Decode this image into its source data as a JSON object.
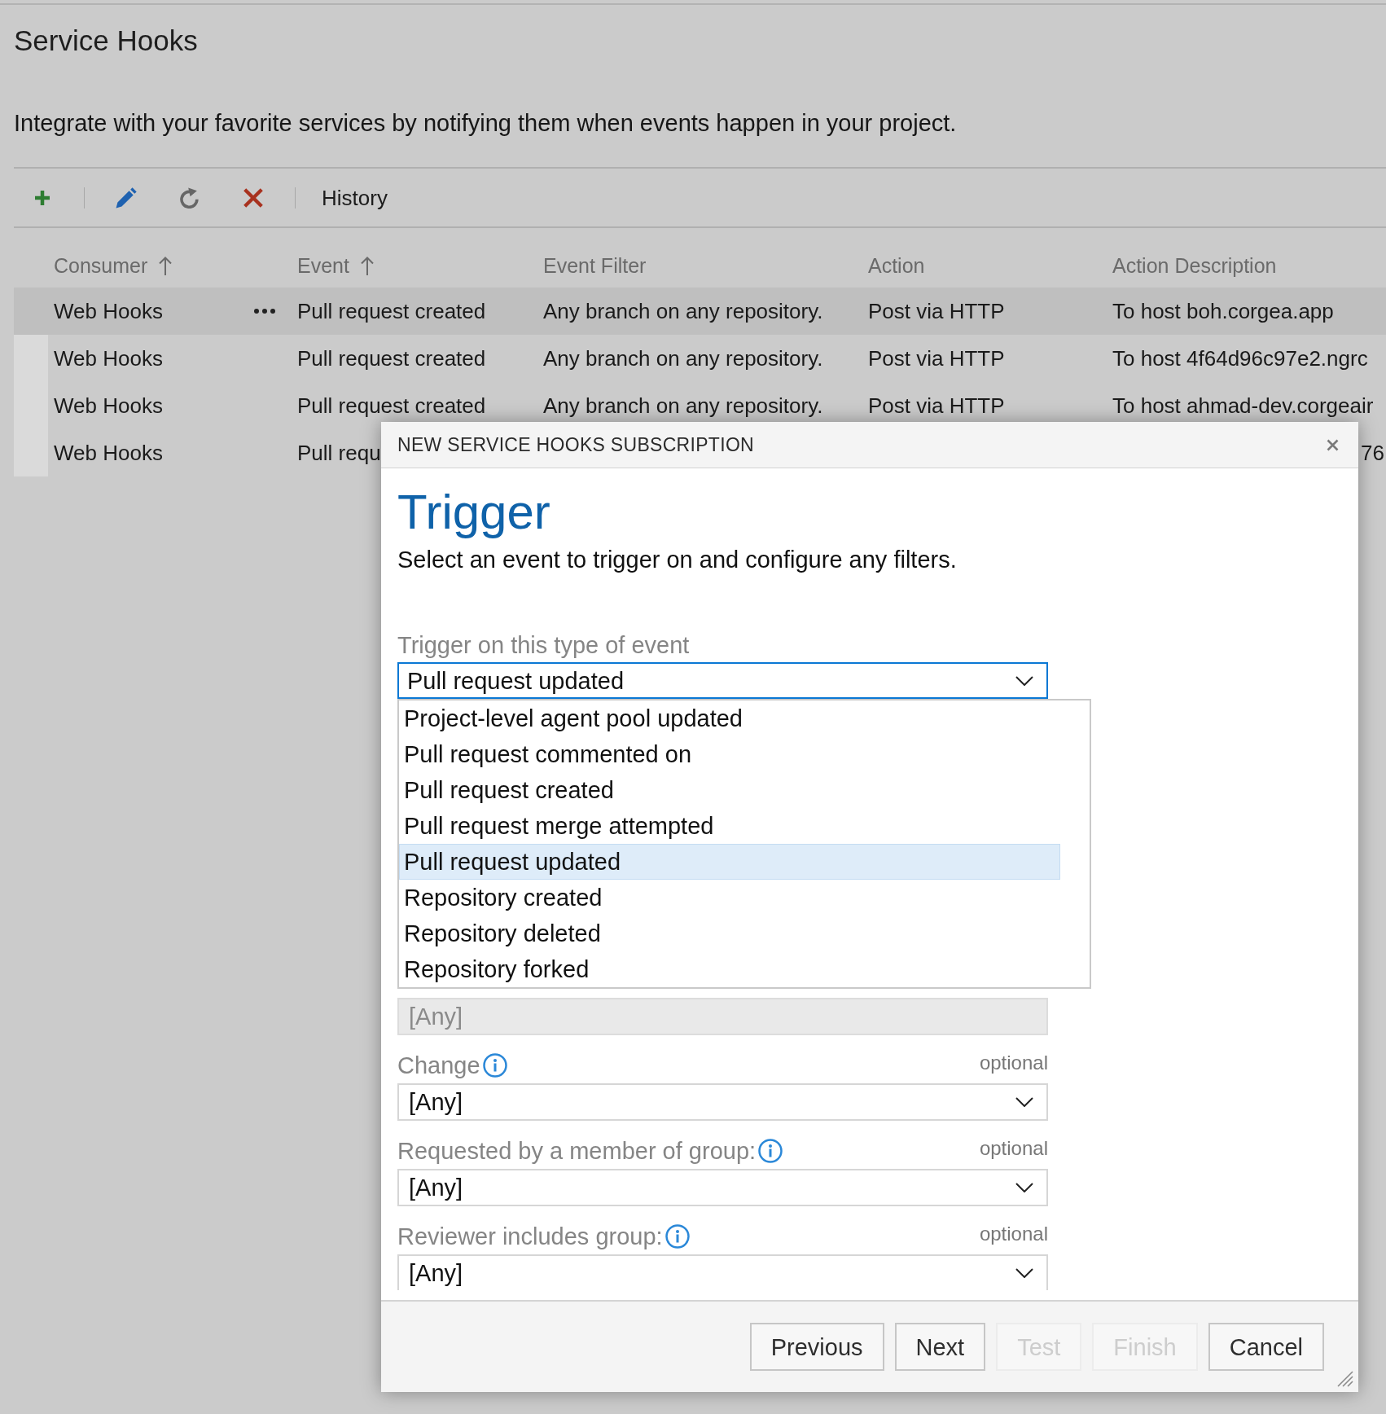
{
  "page": {
    "title": "Service Hooks",
    "description": "Integrate with your favorite services by notifying them when events happen in your project."
  },
  "toolbar": [
    {
      "kind": "add"
    },
    {
      "kind": "separator"
    },
    {
      "kind": "edit"
    },
    {
      "kind": "refresh"
    },
    {
      "kind": "delete"
    },
    {
      "kind": "separator"
    },
    {
      "kind": "text",
      "label": "History"
    }
  ],
  "table": {
    "columns": [
      {
        "label": "Consumer",
        "sorted": true
      },
      {
        "label": "Event",
        "sorted": true
      },
      {
        "label": "Event Filter",
        "sorted": false
      },
      {
        "label": "Action",
        "sorted": false
      },
      {
        "label": "Action Description",
        "sorted": false
      }
    ],
    "rows": [
      {
        "consumer": "Web Hooks",
        "event": "Pull request created",
        "event_filter": "Any branch on any repository.",
        "action": "Post via HTTP",
        "action_description": "To host boh.corgea.app",
        "selected": true,
        "description_start_hidden": false
      },
      {
        "consumer": "Web Hooks",
        "event": "Pull request created",
        "event_filter": "Any branch on any repository.",
        "action": "Post via HTTP",
        "action_description": "To host 4f64d96c97e2.ngrc",
        "selected": false,
        "description_start_hidden": false
      },
      {
        "consumer": "Web Hooks",
        "event": "Pull request created",
        "event_filter": "Any branch on any repository.",
        "action": "Post via HTTP",
        "action_description": "To host ahmad-dev.corgeair",
        "selected": false,
        "description_start_hidden": false
      },
      {
        "consumer": "Web Hooks",
        "event": "Pull requ",
        "action_description": "76",
        "selected": false,
        "description_start_hidden": true
      }
    ]
  },
  "dialog": {
    "title": "NEW SERVICE HOOKS SUBSCRIPTION",
    "heading": "Trigger",
    "subtitle": "Select an event to trigger on and configure any filters.",
    "event_field": {
      "label": "Trigger on this type of event",
      "value": "Pull request updated",
      "expanded": true
    },
    "event_options": [
      {
        "label": "Project-level agent pool updated",
        "selected": false
      },
      {
        "label": "Pull request commented on",
        "selected": false
      },
      {
        "label": "Pull request created",
        "selected": false
      },
      {
        "label": "Pull request merge attempted",
        "selected": false
      },
      {
        "label": "Pull request updated",
        "selected": true
      },
      {
        "label": "Repository created",
        "selected": false
      },
      {
        "label": "Repository deleted",
        "selected": false
      },
      {
        "label": "Repository forked",
        "selected": false
      }
    ],
    "fields": [
      {
        "kind": "textbox",
        "value": "[Any]",
        "disabled": true
      },
      {
        "kind": "dropdown",
        "label": "Change",
        "info": true,
        "note": "optional",
        "value": "[Any]",
        "disabled": false
      },
      {
        "kind": "dropdown",
        "label": "Requested by a member of group:",
        "info": true,
        "note": "optional",
        "value": "[Any]",
        "disabled": false
      },
      {
        "kind": "dropdown",
        "label": "Reviewer includes group:",
        "info": true,
        "note": "optional",
        "value": "[Any]",
        "disabled": false
      }
    ],
    "buttons": [
      {
        "label": "Previous",
        "disabled": false
      },
      {
        "label": "Next",
        "disabled": false
      },
      {
        "label": "Test",
        "disabled": true
      },
      {
        "label": "Finish",
        "disabled": true
      },
      {
        "label": "Cancel",
        "disabled": false
      }
    ]
  }
}
